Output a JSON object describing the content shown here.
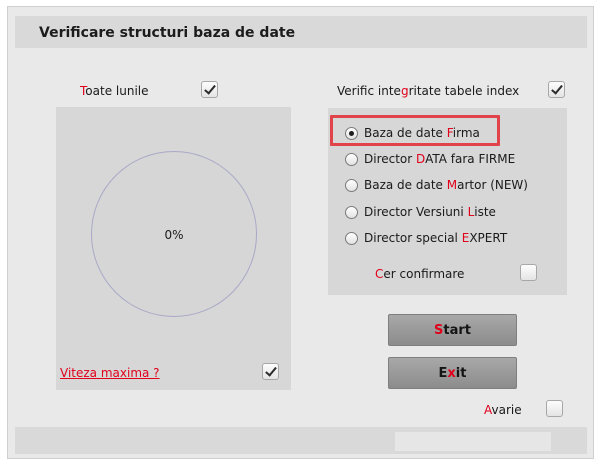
{
  "window": {
    "title": "Verificare structuri baza de date"
  },
  "options": {
    "toate_lunile": {
      "label_accent": "T",
      "label_rest": "oate lunile",
      "checked": true
    },
    "verific_integritate": {
      "label_pre": "Verific inte",
      "label_accent": "g",
      "label_post": "ritate tabele index",
      "checked": true
    },
    "viteza_maxima": {
      "label_accent": "V",
      "label_rest": "iteza maxima ?",
      "checked": true
    },
    "cer_confirmare": {
      "label_accent": "C",
      "label_rest": "er confirmare",
      "checked": false
    },
    "avarie": {
      "label_accent": "A",
      "label_rest": "varie",
      "checked": false
    }
  },
  "progress": {
    "text": "0%",
    "value": 0
  },
  "radio_options": [
    {
      "pre": "Baza de date ",
      "accent": "F",
      "post": "irma",
      "selected": true
    },
    {
      "pre": "Director ",
      "accent": "D",
      "post": "ATA fara FIRME",
      "selected": false
    },
    {
      "pre": "Baza de date ",
      "accent": "M",
      "post": "artor (NEW)",
      "selected": false
    },
    {
      "pre": "Director Versiuni ",
      "accent": "L",
      "post": "iste",
      "selected": false
    },
    {
      "pre": "Director special ",
      "accent": "E",
      "post": "XPERT",
      "selected": false
    }
  ],
  "buttons": {
    "start": {
      "accent": "S",
      "rest": "tart"
    },
    "exit": {
      "pre": "E",
      "accent": "x",
      "post": "it"
    }
  },
  "colors": {
    "accent": "#e0001a",
    "highlight": "#e0444a"
  }
}
